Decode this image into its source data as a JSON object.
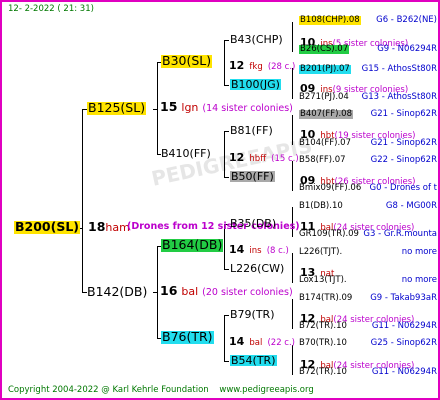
{
  "header": {
    "date": "12-  2-2022 ( 21: 31)"
  },
  "footer": {
    "copyright": "Copyright 2004-2022 @ Karl Kehrle Foundation",
    "website": "www.pedigreeapis.org"
  },
  "main_center": {
    "drones_note": "(Drones from 12 sister colonies)"
  },
  "gen1": {
    "root": "B200(SL)",
    "num": "18",
    "name": "ham"
  },
  "gen2": {
    "top": {
      "code": "B125(SL)",
      "num": "15",
      "name": "lgn",
      "sisters": "(14 sister colonies)"
    },
    "bottom": {
      "code": "B142(DB)",
      "num": "16",
      "name": "bal",
      "sisters": "(20 sister colonies)"
    }
  },
  "gen3": {
    "a": {
      "code": "B30(SL)",
      "num": "12",
      "name": "fkg",
      "sisters": "(28 c.)"
    },
    "b": {
      "code": "B410(FF)",
      "num": "12",
      "name": "hbff",
      "sisters": "(15 c.)"
    },
    "c": {
      "code": "B164(DB)",
      "num": "14",
      "name": "ins",
      "sisters": "(8 c.)"
    },
    "d": {
      "code": "B76(TR)",
      "num": "14",
      "name": "bal",
      "sisters": "(22 c.)"
    }
  },
  "gen4": {
    "a1": {
      "code": "B43(CHP)",
      "num": "10",
      "name": "ins",
      "sisters": "(5 sister colonies)"
    },
    "a2": {
      "code": "B100(JG)",
      "num": "09",
      "name": "ins",
      "sisters": "(9 sister colonies)"
    },
    "b1": {
      "code": "B81(FF)",
      "num": "10",
      "name": "hbt",
      "sisters": "(19 sister colonies)"
    },
    "b2": {
      "code": "B50(FF)",
      "num": "09",
      "name": "hbt",
      "sisters": "(26 sister colonies)"
    },
    "c1": {
      "code": "B35(DB)",
      "num": "11",
      "name": "bal",
      "sisters": "(24 sister colonies)"
    },
    "c2": {
      "code": "L226(CW)",
      "num": "13",
      "name": "nat",
      "sisters": ""
    },
    "d1": {
      "code": "B79(TR)",
      "num": "12",
      "name": "bal",
      "sisters": "(24 sister colonies)"
    },
    "d2": {
      "code": "B54(TR)",
      "num": "12",
      "name": "bal",
      "sisters": "(24 sister colonies)"
    }
  },
  "gen5": [
    {
      "code": "B108(CHP).08",
      "tail": "G6 - B262(NE)"
    },
    {
      "code": "B26(CS).07",
      "tail": "G9 - N06294R"
    },
    {
      "code": "B201(PJ).07",
      "tail": "G15 - AthosSt80R"
    },
    {
      "code": "B271(PJ).04",
      "tail": "G13 - AthosSt80R"
    },
    {
      "code": "B407(FF).08",
      "tail": "G21 - Sinop62R"
    },
    {
      "code": "B104(FF).07",
      "tail": "G21 - Sinop62R"
    },
    {
      "code": "B58(FF).07",
      "tail": "G22 - Sinop62R"
    },
    {
      "code": "Bmix09(FF).06",
      "tail": "G0 - Drones of t"
    },
    {
      "code": "B1(DB).10",
      "tail": "G8 - MG00R"
    },
    {
      "code": "GR109(TR).09",
      "tail": "G3 - Gr.R.mounta"
    },
    {
      "code": "L226(TJT).",
      "tail": "no more"
    },
    {
      "code": "Lox13(TJT).",
      "tail": "no more"
    },
    {
      "code": "B174(TR).09",
      "tail": "G9 - Takab93aR"
    },
    {
      "code": "B72(TR).10",
      "tail": "G11 - N06294R"
    },
    {
      "code": "B70(TR).10",
      "tail": "G25 - Sinop62R"
    },
    {
      "code": "B72(TR).10",
      "tail": "G11 - N06294R"
    }
  ],
  "colors": {
    "border": "#e000c0",
    "gold": "#ffe400",
    "green": "#22cc44",
    "cyan": "#22ddee",
    "grey": "#a9a9a9",
    "footer": "#007700"
  }
}
